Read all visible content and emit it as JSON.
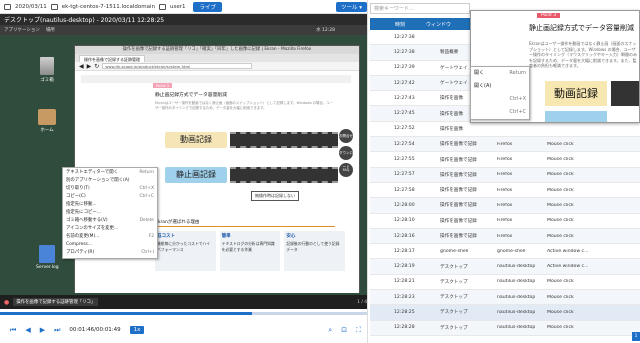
{
  "topbar": {
    "date": "2020/03/11",
    "host": "ek-tgt-centos-7-1511.localdomain",
    "user": "user1",
    "live_label": "ライブ",
    "tool_label": "ツール"
  },
  "titlebar": {
    "title": "デスクトップ(nautilus-desktop) - 2020/03/11 12:28:25"
  },
  "gnome": {
    "apps": "アプリケーション",
    "places": "場所",
    "clock": "水 12:28"
  },
  "desktop": {
    "trash_label": "ゴミ箱",
    "home_label": "ホーム",
    "log_label": "Server.log"
  },
  "firefox": {
    "title": "操作を画像で記録する証跡管理「リコ」「確実」「同年」した画像に記録 | Ekran - Mozilla Firefox",
    "tab": "操作を画像で記録する証跡管理",
    "url": "www.jtk-scape.jp/product/ekran/system.html",
    "point_tag": "Point 3",
    "heading": "静止画記録方式でデータ容量削減",
    "desc": "Ekranはユーザー操作を動画ではなく静止画（画面のスナップショット）として記録します。Windows の場合、ユーザー操作のタイミングで記録するため、データ量を大幅に削減できます。",
    "btn_video": "動画記録",
    "btn_still": "静止画記録",
    "film_caption": "無操作時は記録しない",
    "circle_1": "お問合せ",
    "circle_2": "ダウンロード",
    "circle_3": "FAQ",
    "section_heading": "Ekranが選ばれる理由",
    "cards": [
      {
        "title": "低コスト",
        "text": "機能毎に分かったコストでハイパフォーマンス"
      },
      {
        "title": "簡単",
        "text": "テキストログの分析は専門知識を必要とする作業"
      },
      {
        "title": "安心",
        "text": "記録後の行動のとして使う記録データ"
      }
    ]
  },
  "context_menu": {
    "items": [
      {
        "label": "テキストエディターで開く",
        "shortcut": "Return"
      },
      {
        "label": "別のアプリケーションで開く(A)",
        "shortcut": ""
      },
      {
        "label": "切り取り(T)",
        "shortcut": "Ctrl+X"
      },
      {
        "label": "コピー(C)",
        "shortcut": "Ctrl+C"
      },
      {
        "label": "指定先に移動...",
        "shortcut": ""
      },
      {
        "label": "指定先にコピー...",
        "shortcut": ""
      },
      {
        "label": "ゴミ箱へ移動する(V)",
        "shortcut": "Delete"
      },
      {
        "label": "アイコンのサイズを変更...",
        "shortcut": ""
      },
      {
        "label": "名前の変更(M)...",
        "shortcut": "F2"
      },
      {
        "label": "Compress...",
        "shortcut": ""
      },
      {
        "label": "プロパティ(R)",
        "shortcut": "Ctrl+I"
      }
    ]
  },
  "taskbar": {
    "item": "操作を画像で記録する証跡管理「リコ」",
    "count": "1 / 4"
  },
  "player": {
    "progress": 0.68,
    "time": "00:01:46/00:01:49",
    "speed": "1x"
  },
  "panel": {
    "search_placeholder": "検索キーワード...",
    "headers": {
      "time": "時刻",
      "window": "ウィンドウ"
    },
    "rows": [
      {
        "time": "12:27:38",
        "window": "",
        "app": "",
        "event": ""
      },
      {
        "time": "12:27:38",
        "window": "製品概要",
        "app": "",
        "event": ""
      },
      {
        "time": "12:27:39",
        "window": "ゲートウェイ",
        "app": "",
        "event": ""
      },
      {
        "time": "12:27:42",
        "window": "ゲートウェイ",
        "app": "",
        "event": ""
      },
      {
        "time": "12:27:43",
        "window": "操作を画像",
        "app": "",
        "event": ""
      },
      {
        "time": "12:27:45",
        "window": "操作を画像",
        "app": "",
        "event": ""
      },
      {
        "time": "12:27:52",
        "window": "操作を画像",
        "app": "",
        "event": ""
      },
      {
        "time": "12:27:54",
        "window": "操作を画像で記録",
        "app": "Firefox",
        "event": "Mouse click"
      },
      {
        "time": "12:27:55",
        "window": "操作を画像で記録",
        "app": "Firefox",
        "event": "Mouse click"
      },
      {
        "time": "12:27:57",
        "window": "操作を画像で記録",
        "app": "Firefox",
        "event": "Mouse click"
      },
      {
        "time": "12:27:58",
        "window": "操作を画像で記録",
        "app": "Firefox",
        "event": "Mouse click"
      },
      {
        "time": "12:28:00",
        "window": "操作を画像で記録",
        "app": "Firefox",
        "event": "Mouse click"
      },
      {
        "time": "12:28:10",
        "window": "操作を画像で記録",
        "app": "Firefox",
        "event": "Mouse click"
      },
      {
        "time": "12:28:16",
        "window": "操作を画像で記録",
        "app": "Firefox",
        "event": "Mouse click"
      },
      {
        "time": "12:28:17",
        "window": "gnome-shell",
        "app": "gnome-shell",
        "event": "Active window c..."
      },
      {
        "time": "12:28:19",
        "window": "デスクトップ",
        "app": "nautilus-desktop",
        "event": "Active window c..."
      },
      {
        "time": "12:28:21",
        "window": "デスクトップ",
        "app": "nautilus-desktop",
        "event": "Mouse click"
      },
      {
        "time": "12:28:23",
        "window": "デスクトップ",
        "app": "nautilus-desktop",
        "event": "Mouse click"
      },
      {
        "time": "12:28:25",
        "window": "デスクトップ",
        "app": "nautilus-desktop",
        "event": "Mouse click"
      },
      {
        "time": "12:28:28",
        "window": "デスクトップ",
        "app": "nautilus-desktop",
        "event": "Mouse click"
      }
    ],
    "selected_index": 18,
    "pager": "1"
  },
  "popover": {
    "tag": "Point 3",
    "title": "静止画記録方式でデータ容量削減",
    "desc": "Ekranはユーザー操作を動画ではなく静止画（画面のスナップショット）として記録します。Windows の場合、ユーザー操作のタイミング（マウスクリックやキー入力）瞬間のみを記録するため、データ量を大幅に削減できます。また、監査者の負担も軽減できます。",
    "big_label": "動画記録"
  },
  "context_menu_2": {
    "items": [
      {
        "label": "開く",
        "shortcut": "Return"
      },
      {
        "label": "開く(A)",
        "shortcut": ""
      },
      {
        "label": "",
        "shortcut": "Ctrl+X"
      },
      {
        "label": "",
        "shortcut": "Ctrl+C"
      }
    ]
  }
}
